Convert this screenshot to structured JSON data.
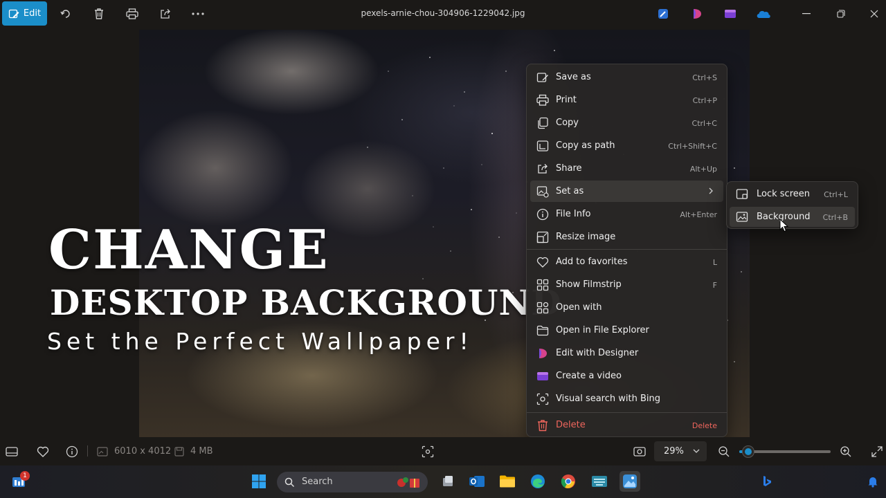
{
  "toolbar": {
    "edit_label": "Edit",
    "file_name": "pexels-arnie-chou-304906-1229042.jpg",
    "icons": [
      "rotate-icon",
      "delete-icon",
      "print-icon",
      "share-icon",
      "more-icon"
    ],
    "right_apps": [
      "designer-pen-icon",
      "designer-icon",
      "clipchamp-icon",
      "onedrive-icon"
    ],
    "window_controls": [
      "minimize-icon",
      "restore-icon",
      "close-icon"
    ]
  },
  "overlay": {
    "line1": "CHANGE",
    "line2": "DESKTOP BACKGROUND",
    "line3": "Set the Perfect Wallpaper!"
  },
  "menu": {
    "items": [
      {
        "label": "Save as",
        "shortcut": "Ctrl+S",
        "icon": "save-as-icon"
      },
      {
        "label": "Print",
        "shortcut": "Ctrl+P",
        "icon": "print-icon"
      },
      {
        "label": "Copy",
        "shortcut": "Ctrl+C",
        "icon": "copy-icon"
      },
      {
        "label": "Copy as path",
        "shortcut": "Ctrl+Shift+C",
        "icon": "copy-path-icon"
      },
      {
        "label": "Share",
        "shortcut": "Alt+Up",
        "icon": "share-icon"
      },
      {
        "label": "Set as",
        "shortcut": "",
        "icon": "set-as-icon",
        "submenu": true
      },
      {
        "label": "File Info",
        "shortcut": "Alt+Enter",
        "icon": "info-icon"
      },
      {
        "label": "Resize image",
        "shortcut": "",
        "icon": "resize-icon"
      },
      {
        "label": "Add to favorites",
        "shortcut": "L",
        "icon": "heart-icon"
      },
      {
        "label": "Show Filmstrip",
        "shortcut": "F",
        "icon": "filmstrip-icon"
      },
      {
        "label": "Open with",
        "shortcut": "",
        "icon": "open-with-icon"
      },
      {
        "label": "Open in File Explorer",
        "shortcut": "",
        "icon": "folder-icon"
      },
      {
        "label": "Edit with Designer",
        "shortcut": "",
        "icon": "designer-icon"
      },
      {
        "label": "Create a video",
        "shortcut": "",
        "icon": "clipchamp-icon"
      },
      {
        "label": "Visual search with Bing",
        "shortcut": "",
        "icon": "visual-search-icon"
      },
      {
        "label": "Delete",
        "shortcut": "Delete",
        "icon": "trash-icon"
      }
    ]
  },
  "submenu": {
    "items": [
      {
        "label": "Lock screen",
        "shortcut": "Ctrl+L",
        "icon": "lock-screen-icon"
      },
      {
        "label": "Background",
        "shortcut": "Ctrl+B",
        "icon": "background-icon"
      }
    ]
  },
  "status": {
    "dimensions": "6010 x 4012",
    "size": "4 MB",
    "zoom": "29%",
    "zoom_fraction": 0.1
  },
  "taskbar": {
    "search_placeholder": "Search",
    "widget_badge": "1",
    "apps": [
      "start-icon",
      "search-icon",
      "task-view-icon",
      "outlook-icon",
      "file-explorer-icon",
      "edge-icon",
      "chrome-icon",
      "keyboard-app-icon",
      "photos-icon"
    ]
  },
  "colors": {
    "accent": "#1b8ec9",
    "danger": "#f0665d",
    "menu_bg": "#282625"
  }
}
